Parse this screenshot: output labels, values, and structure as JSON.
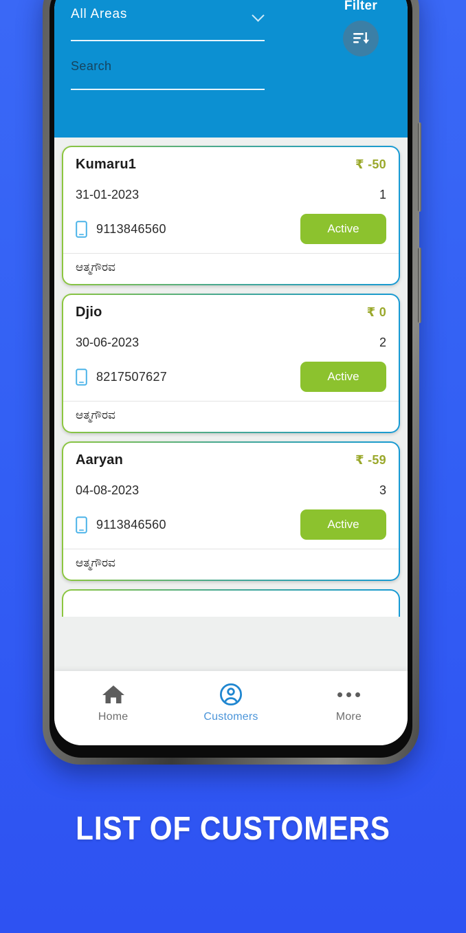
{
  "screen": {
    "header": {
      "area_filter": {
        "label": "area-select",
        "value": "All Areas",
        "icon": "chevron-down-icon"
      },
      "search": {
        "value": "",
        "placeholder": "Search"
      },
      "filter": {
        "label": "Filter",
        "icon": "sort-filter-icon"
      },
      "background_color": "#0c90d2"
    },
    "customers": [
      {
        "name": "Kumaru1",
        "amount": "₹ -50",
        "date": "31-01-2023",
        "index": "1",
        "phone": "9113846560",
        "status": "Active",
        "group": "ಆತ್ಮಗೌರವ"
      },
      {
        "name": "Djio",
        "amount": "₹ 0",
        "date": "30-06-2023",
        "index": "2",
        "phone": "8217507627",
        "status": "Active",
        "group": "ಆತ್ಮಗೌರವ"
      },
      {
        "name": "Aaryan",
        "amount": "₹ -59",
        "date": "04-08-2023",
        "index": "3",
        "phone": "9113846560",
        "status": "Active",
        "group": "ಆತ್ಮಗೌರವ"
      }
    ],
    "bottom_nav": {
      "items": [
        {
          "label": "Home",
          "icon": "home-icon",
          "active": false
        },
        {
          "label": "Customers",
          "icon": "user-circle-icon",
          "active": true
        },
        {
          "label": "More",
          "icon": "more-dots-icon",
          "active": false
        }
      ],
      "active_color": "#4a94d9",
      "inactive_color": "#6e6e6e"
    }
  },
  "caption": {
    "text": "LIST OF CUSTOMERS"
  },
  "colors": {
    "page_background": "#3360f4",
    "header_blue": "#0c90d2",
    "status_green": "#8cc22e",
    "amount_olive": "#9aa82b",
    "card_border_start": "#8cc63f",
    "card_border_end": "#179ad4"
  }
}
